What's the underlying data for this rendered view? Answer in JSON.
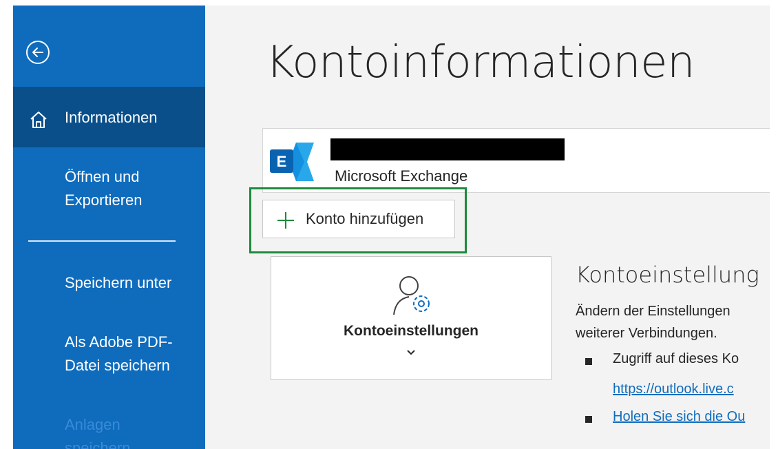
{
  "sidebar": {
    "back_icon": "back-arrow-circle-icon",
    "items": [
      {
        "label": "Informationen",
        "icon": "home-icon",
        "active": true
      },
      {
        "label_line1": "Öffnen und",
        "label_line2": "Exportieren"
      },
      {
        "label": "Speichern unter"
      },
      {
        "label_line1": "Als Adobe PDF-",
        "label_line2": "Datei speichern"
      },
      {
        "label_line1": "Anlagen",
        "label_line2": "speichern",
        "disabled": true
      }
    ]
  },
  "main": {
    "title": "Kontoinformationen",
    "account": {
      "type": "Microsoft Exchange",
      "logo_icon": "exchange-logo-icon",
      "logo_letter": "E"
    },
    "add_account": {
      "label": "Konto hinzufügen",
      "icon": "plus-icon",
      "highlight_color": "#1c8a3c"
    },
    "settings_tile": {
      "label": "Kontoeinstellungen",
      "icon": "person-gear-icon",
      "dropdown_icon": "chevron-down-icon"
    },
    "settings_section": {
      "title": "Kontoeinstellung",
      "desc_line1": "Ändern der Einstellungen",
      "desc_line2": "weiterer Verbindungen.",
      "bullet1_text": "Zugriff auf dieses Ko",
      "bullet1_link": "https://outlook.live.c",
      "bullet2_link": "Holen Sie sich die Ou"
    }
  },
  "colors": {
    "sidebar_bg": "#0f6cbd",
    "sidebar_active_bg": "#0a4f8a",
    "main_bg": "#f3f3f3",
    "link": "#0f6cbd"
  }
}
